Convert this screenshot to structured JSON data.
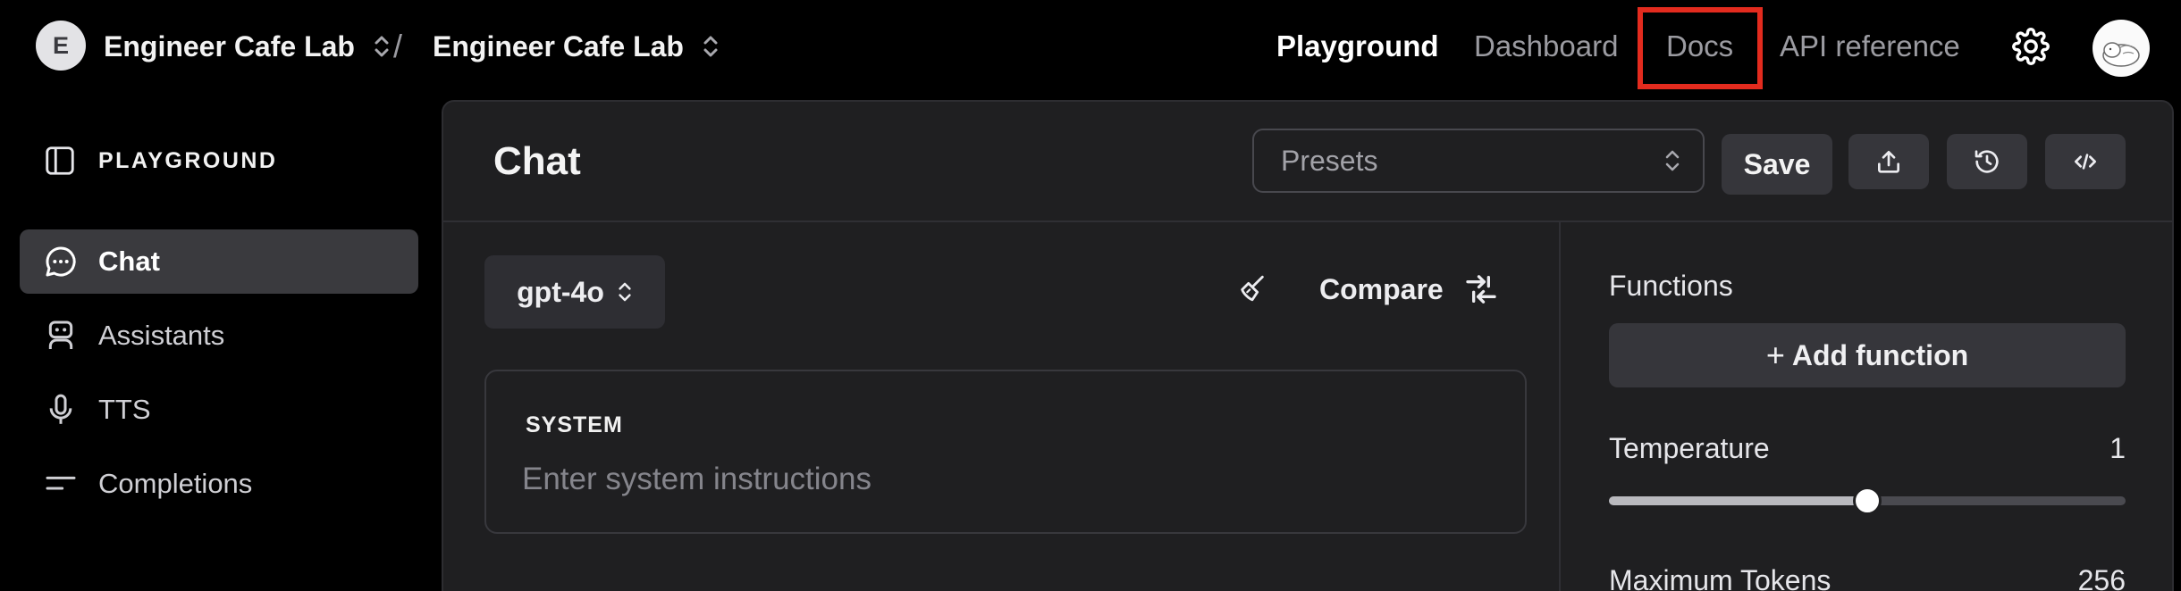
{
  "topbar": {
    "org_initial": "E",
    "org_name": "Engineer Cafe Lab",
    "project_name": "Engineer Cafe Lab",
    "separator": "/",
    "nav": [
      {
        "label": "Playground",
        "active": true
      },
      {
        "label": "Dashboard",
        "active": false
      },
      {
        "label": "Docs",
        "active": false,
        "highlighted": true
      },
      {
        "label": "API reference",
        "active": false
      }
    ],
    "settings_icon": "gear-icon",
    "highlight_color": "#e32b1e"
  },
  "sidebar": {
    "header": "PLAYGROUND",
    "items": [
      {
        "label": "Chat",
        "icon": "chat-bubble-icon",
        "active": true
      },
      {
        "label": "Assistants",
        "icon": "robot-icon",
        "active": false
      },
      {
        "label": "TTS",
        "icon": "microphone-icon",
        "active": false
      },
      {
        "label": "Completions",
        "icon": "lines-icon",
        "active": false
      }
    ]
  },
  "main": {
    "title": "Chat",
    "presets_placeholder": "Presets",
    "save_label": "Save",
    "model": "gpt-4o",
    "compare_label": "Compare",
    "system": {
      "label": "SYSTEM",
      "placeholder": "Enter system instructions"
    },
    "settings": {
      "functions_label": "Functions",
      "add_function_label": "Add function",
      "temperature_label": "Temperature",
      "temperature_value": "1",
      "temperature_fraction": 0.5,
      "max_tokens_label": "Maximum Tokens",
      "max_tokens_value": "256"
    }
  }
}
